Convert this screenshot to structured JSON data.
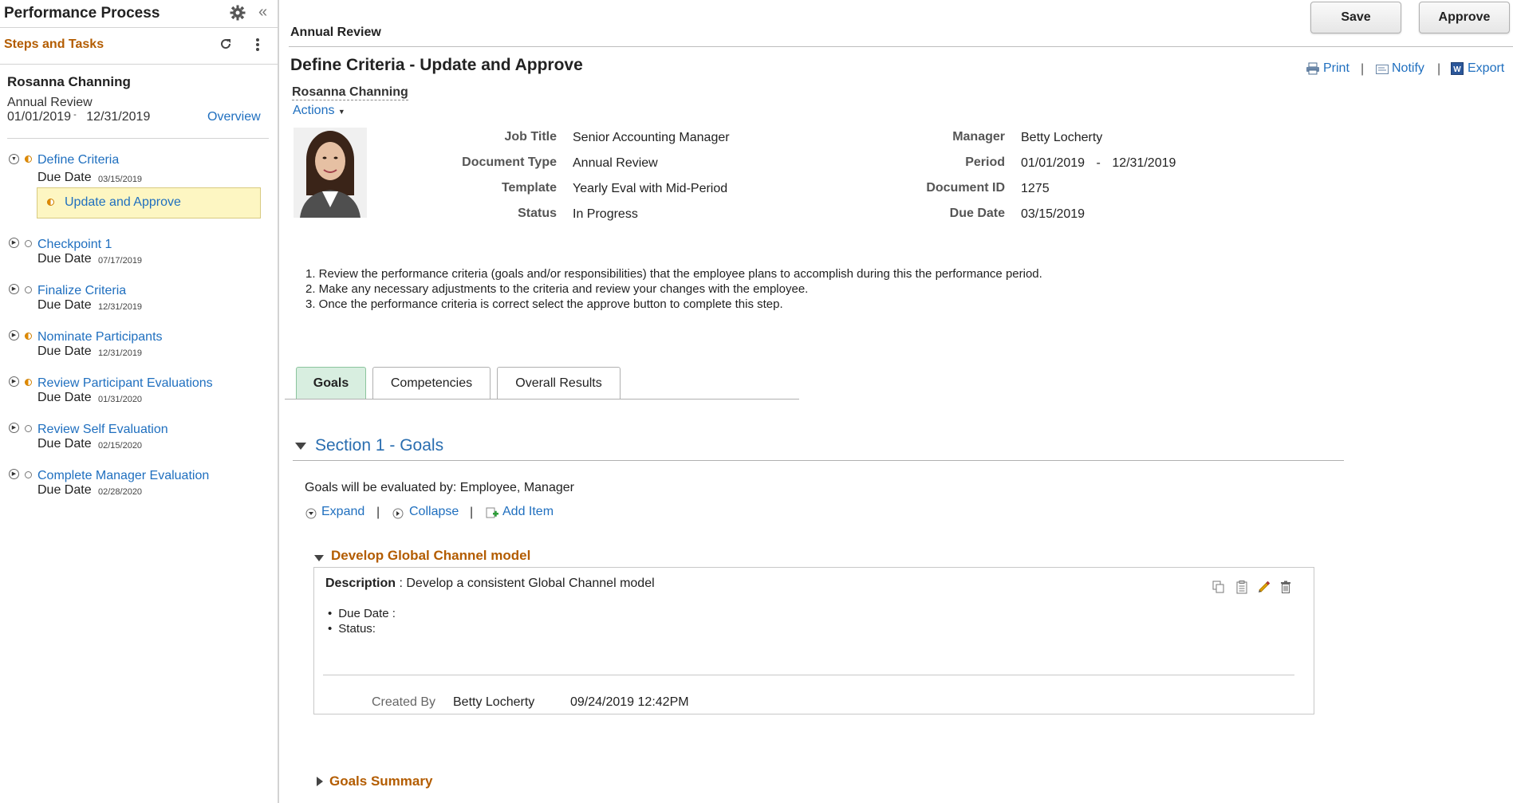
{
  "sidebar": {
    "title": "Performance Process",
    "subtitle": "Steps and Tasks",
    "employee": "Rosanna Channing",
    "document_type": "Annual Review",
    "period_start": "01/01/2019",
    "period_end": "12/31/2019",
    "overview_label": "Overview",
    "due_label": "Due Date",
    "steps": [
      {
        "name": "Define Criteria",
        "due": "03/15/2019",
        "status": "in-progress",
        "expanded": true
      },
      {
        "name": "Checkpoint 1",
        "due": "07/17/2019",
        "status": "not-started"
      },
      {
        "name": "Finalize Criteria",
        "due": "12/31/2019",
        "status": "not-started"
      },
      {
        "name": "Nominate Participants",
        "due": "12/31/2019",
        "status": "in-progress"
      },
      {
        "name": "Review Participant Evaluations",
        "due": "01/31/2020",
        "status": "in-progress"
      },
      {
        "name": "Review Self Evaluation",
        "due": "02/15/2020",
        "status": "not-started"
      },
      {
        "name": "Complete Manager Evaluation",
        "due": "02/28/2020",
        "status": "not-started"
      }
    ],
    "active_task": "Update and Approve"
  },
  "header": {
    "breadcrumb": "Annual Review",
    "save_label": "Save",
    "approve_label": "Approve"
  },
  "page": {
    "title": "Define Criteria - Update and Approve",
    "employee_link": "Rosanna Channing",
    "actions_label": "Actions",
    "print_label": "Print",
    "notify_label": "Notify",
    "export_label": "Export"
  },
  "details": {
    "job_title_label": "Job Title",
    "job_title": "Senior Accounting Manager",
    "document_type_label": "Document Type",
    "document_type": "Annual Review",
    "template_label": "Template",
    "template": "Yearly Eval with Mid-Period",
    "status_label": "Status",
    "status": "In Progress",
    "manager_label": "Manager",
    "manager": "Betty Locherty",
    "period_label": "Period",
    "period_start": "01/01/2019",
    "period_end": "12/31/2019",
    "document_id_label": "Document ID",
    "document_id": "1275",
    "due_date_label": "Due Date",
    "due_date": "03/15/2019"
  },
  "instructions": [
    "1. Review the performance criteria (goals and/or responsibilities) that the employee plans to accomplish during this the performance period.",
    "2. Make any necessary adjustments to the criteria and review your changes with the employee.",
    "3. Once the performance criteria is correct select the approve button to complete this step."
  ],
  "tabs": [
    {
      "label": "Goals",
      "active": true
    },
    {
      "label": "Competencies",
      "active": false
    },
    {
      "label": "Overall Results",
      "active": false
    }
  ],
  "section": {
    "title": "Section 1 - Goals",
    "evaluated_by": "Goals will be evaluated by: Employee, Manager",
    "expand_label": "Expand",
    "collapse_label": "Collapse",
    "add_item_label": "Add Item"
  },
  "goal": {
    "title": "Develop Global Channel model",
    "description_label": "Description",
    "description": "Develop a consistent Global Channel model",
    "due_date_label": "Due Date :",
    "status_label": "Status:",
    "created_by_label": "Created By",
    "created_by": "Betty Locherty",
    "created_at": "09/24/2019 12:42PM"
  },
  "summary": {
    "title": "Goals Summary"
  },
  "colors": {
    "link": "#1f6fbf",
    "accent_orange": "#b35c00",
    "tab_active_bg": "#d8eee0",
    "task_highlight": "#fdf6c2"
  }
}
